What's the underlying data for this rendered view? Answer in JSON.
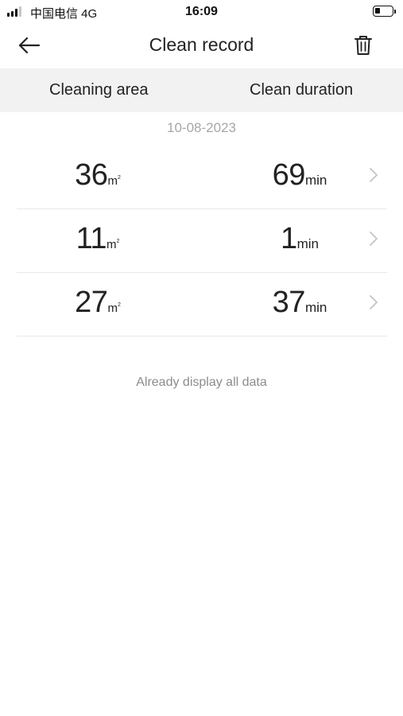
{
  "status_bar": {
    "carrier": "中国电信  4G",
    "time": "16:09",
    "battery_level": 0.3,
    "signal_bars_active": 3,
    "signal_bars_total": 4
  },
  "header": {
    "title": "Clean record",
    "back_icon": "arrow-left-icon",
    "delete_icon": "trash-icon"
  },
  "columns": {
    "area": "Cleaning area",
    "duration": "Clean duration"
  },
  "date": "10-08-2023",
  "records": [
    {
      "area": "36",
      "area_unit": "m",
      "area_unit_sup": "2",
      "duration": "69",
      "duration_unit": "min"
    },
    {
      "area": "11",
      "area_unit": "m",
      "area_unit_sup": "2",
      "duration": "1",
      "duration_unit": "min"
    },
    {
      "area": "27",
      "area_unit": "m",
      "area_unit_sup": "2",
      "duration": "37",
      "duration_unit": "min"
    }
  ],
  "footer_note": "Already display all data",
  "colors": {
    "text": "#222222",
    "muted": "#a6a6a6",
    "band": "#f2f2f2",
    "divider": "#e9e9e9",
    "chevron": "#c4c4c4"
  }
}
